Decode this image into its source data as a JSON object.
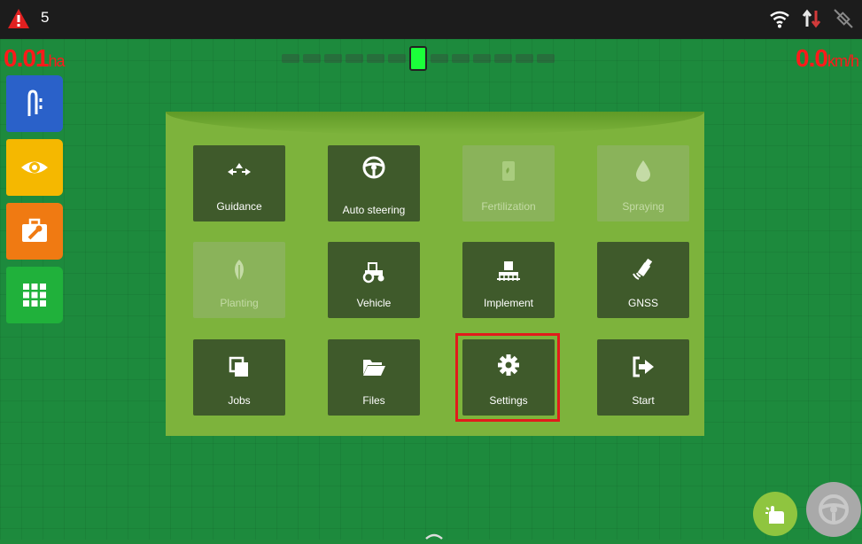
{
  "status_bar": {
    "alert_count": "5",
    "icons": [
      "wifi-icon",
      "data-transfer-icon",
      "satellite-off-icon"
    ]
  },
  "overlay": {
    "area_value": "0.01",
    "area_unit": "ha",
    "speed_value": "0.0",
    "speed_unit": "km/h"
  },
  "sidebar": {
    "items": [
      {
        "name": "guidance-lines",
        "icon": "guidance-path-icon",
        "color": "#2a61c9"
      },
      {
        "name": "view",
        "icon": "eye-icon",
        "color": "#f5b800"
      },
      {
        "name": "tools",
        "icon": "toolbox-icon",
        "color": "#f07a12"
      },
      {
        "name": "apps",
        "icon": "grid-icon",
        "color": "#20b13b"
      }
    ]
  },
  "menu": {
    "tiles": [
      {
        "label": "Guidance",
        "icon": "arrows-icon",
        "enabled": true
      },
      {
        "label": "Auto steering",
        "icon": "steering-wheel-icon",
        "enabled": true
      },
      {
        "label": "Fertilization",
        "icon": "fertilizer-bag-icon",
        "enabled": false
      },
      {
        "label": "Spraying",
        "icon": "droplet-icon",
        "enabled": false
      },
      {
        "label": "Planting",
        "icon": "leaf-icon",
        "enabled": false
      },
      {
        "label": "Vehicle",
        "icon": "tractor-icon",
        "enabled": true
      },
      {
        "label": "Implement",
        "icon": "implement-icon",
        "enabled": true
      },
      {
        "label": "GNSS",
        "icon": "satellite-icon",
        "enabled": true
      },
      {
        "label": "Jobs",
        "icon": "copy-icon",
        "enabled": true
      },
      {
        "label": "Files",
        "icon": "folder-open-icon",
        "enabled": true
      },
      {
        "label": "Settings",
        "icon": "gear-icon",
        "enabled": true
      },
      {
        "label": "Start",
        "icon": "sign-in-icon",
        "enabled": true
      }
    ],
    "highlighted": "Settings"
  },
  "colors": {
    "alert": "#e02020",
    "area_speed_text": "#ff1a1a",
    "panel": "#7db33c",
    "tile": "#3f5a2b",
    "highlight": "#e11b1b"
  }
}
